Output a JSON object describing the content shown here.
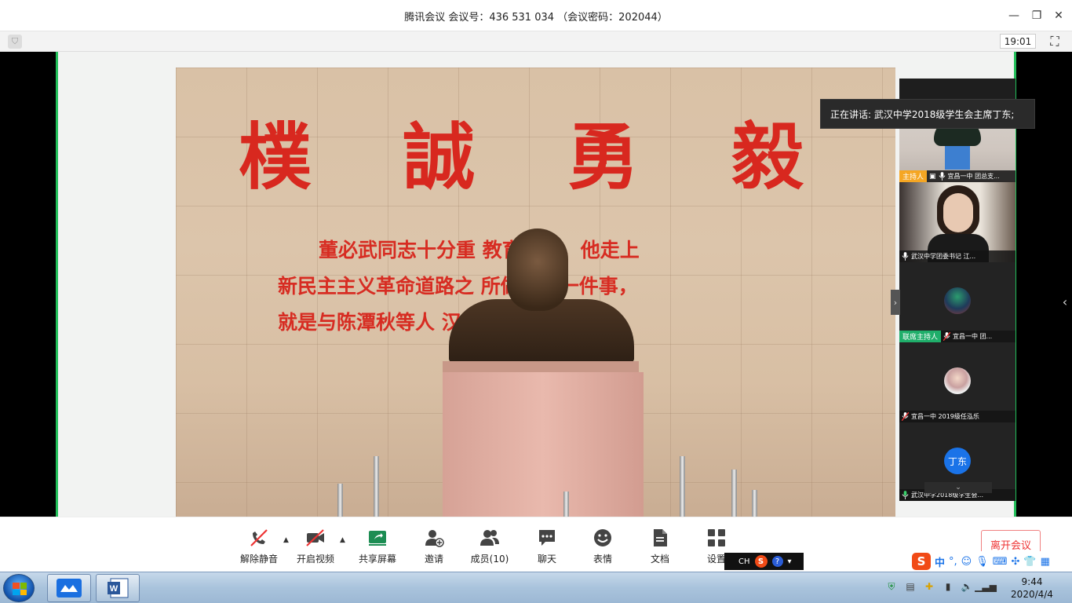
{
  "window": {
    "title": "腾讯会议 会议号：436 531 034 （会议密码：202044）",
    "meeting_timer": "19:01"
  },
  "share": {
    "big_characters": [
      "樸",
      "誠",
      "勇",
      "毅"
    ],
    "inscription": [
      "董必武同志十分重  教育事业，他走上",
      "新民主主义革命道路之  所做的第一件事，",
      "就是与陈潭秋等人  汉中学。"
    ]
  },
  "speaking": {
    "text": "正在讲话: 武汉中学2018级学生会主席丁东;"
  },
  "participants": [
    {
      "tag": "主持人",
      "tag_type": "host",
      "name": "宜昌一中 团总支..."
    },
    {
      "tag": "",
      "tag_type": "",
      "name": "武汉中学团委书记 江..."
    },
    {
      "tag": "联席主持人",
      "tag_type": "cohost",
      "name": "宜昌一中 团..."
    },
    {
      "tag": "",
      "tag_type": "",
      "name": "宜昌一中 2019级任泓乐"
    },
    {
      "tag": "",
      "tag_type": "",
      "name": "武汉中学2018级学生会...",
      "avatar_text": "丁东"
    }
  ],
  "toolbar": {
    "unmute": "解除静音",
    "start_video": "开启视频",
    "share_screen": "共享屏幕",
    "invite": "邀请",
    "members": "成员(10)",
    "chat": "聊天",
    "reactions": "表情",
    "docs": "文档",
    "settings": "设置",
    "leave": "离开会议"
  },
  "ime": {
    "small_lang": "CH",
    "mode": "中",
    "punct": "°,"
  },
  "taskbar": {
    "time": "9:44",
    "date": "2020/4/4"
  },
  "colors": {
    "accent_green": "#22c05a",
    "host_tag": "#f5a623",
    "cohost_tag": "#1fae6a",
    "leave_red": "#e33333",
    "avatar_blue": "#1a73e8"
  }
}
